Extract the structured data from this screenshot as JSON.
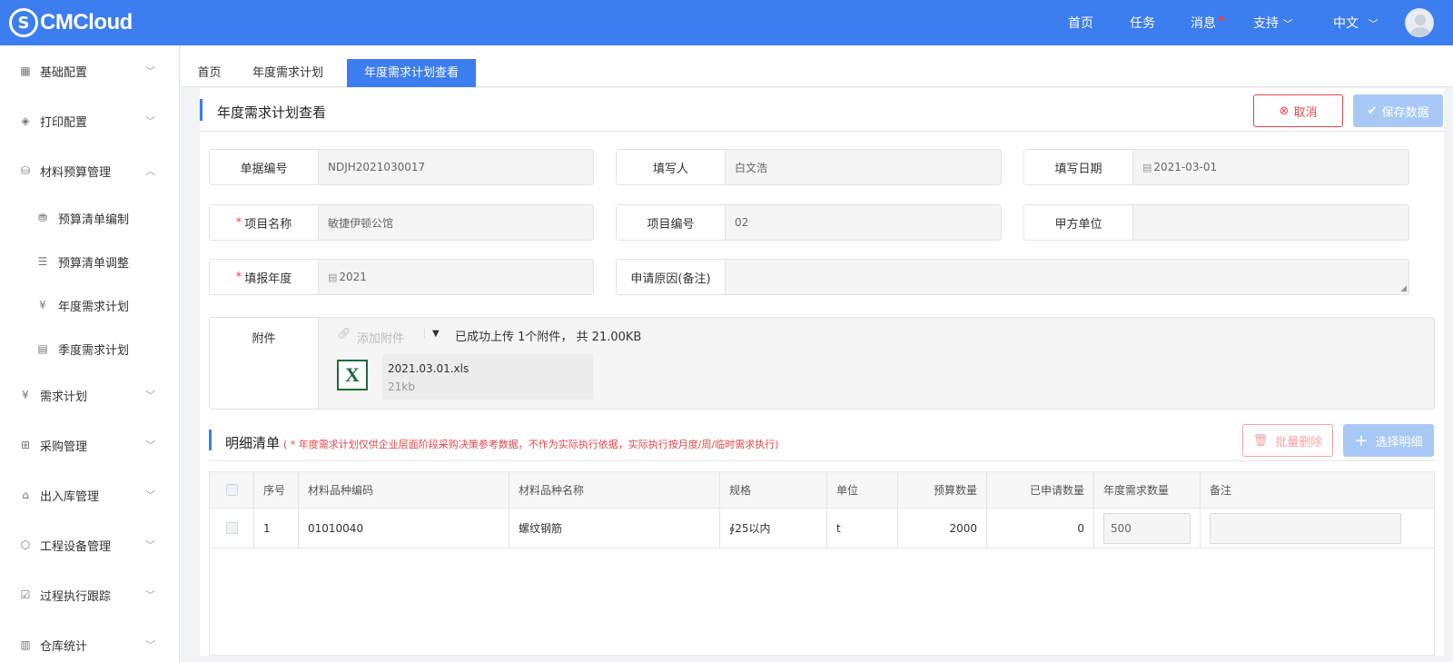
{
  "app": {
    "logo_text": "CMCloud",
    "logo_mark": "S"
  },
  "topnav": {
    "home": "首页",
    "tasks": "任务",
    "messages": "消息",
    "support": "支持",
    "language": "中文"
  },
  "sidebar": {
    "items": [
      {
        "label": "基础配置",
        "icon": "grid-icon"
      },
      {
        "label": "打印配置",
        "icon": "layers-icon"
      },
      {
        "label": "材料预算管理",
        "icon": "database-icon"
      },
      {
        "label": "预算清单编制",
        "icon": "coins-icon"
      },
      {
        "label": "预算清单调整",
        "icon": "list-doc-icon"
      },
      {
        "label": "年度需求计划",
        "icon": "yen-search-icon"
      },
      {
        "label": "季度需求计划",
        "icon": "calendar-icon"
      },
      {
        "label": "需求计划",
        "icon": "yen-search-icon"
      },
      {
        "label": "采购管理",
        "icon": "org-chart-icon"
      },
      {
        "label": "出入库管理",
        "icon": "warehouse-icon"
      },
      {
        "label": "工程设备管理",
        "icon": "cube-icon"
      },
      {
        "label": "过程执行跟踪",
        "icon": "tracking-icon"
      },
      {
        "label": "仓库统计",
        "icon": "stats-icon"
      }
    ]
  },
  "tabs": [
    {
      "label": "首页"
    },
    {
      "label": "年度需求计划"
    },
    {
      "label": "年度需求计划查看"
    }
  ],
  "page": {
    "title": "年度需求计划查看",
    "cancel_label": "取消",
    "save_label": "保存数据"
  },
  "form": {
    "doc_no": {
      "label": "单据编号",
      "value": "NDJH2021030017"
    },
    "filler": {
      "label": "填写人",
      "value": "白文浩"
    },
    "fill_date": {
      "label": "填写日期",
      "value": "2021-03-01"
    },
    "project_name": {
      "label": "项目名称",
      "value": "敏捷伊顿公馆"
    },
    "project_no": {
      "label": "项目编号",
      "value": "02"
    },
    "party_a": {
      "label": "甲方单位",
      "value": ""
    },
    "report_year": {
      "label": "填报年度",
      "value": "2021"
    },
    "reason": {
      "label": "申请原因(备注)",
      "value": ""
    },
    "required_mark": "*"
  },
  "attachment": {
    "label": "附件",
    "add_label": "添加附件",
    "summary": "已成功上传 1个附件， 共 21.00KB",
    "file": {
      "name": "2021.03.01.xls",
      "size": "21kb",
      "icon_letter": "X"
    }
  },
  "detail": {
    "title": "明细清单",
    "note": "( * 年度需求计划仅供企业层面阶段采购决策参考数据，不作为实际执行依据，实际执行按月度/周/临时需求执行)",
    "batch_delete_label": "批量删除",
    "select_label": "选择明细",
    "columns": [
      "序号",
      "材料品种编码",
      "材料品种名称",
      "规格",
      "单位",
      "预算数量",
      "已申请数量",
      "年度需求数量",
      "备注"
    ],
    "rows": [
      {
        "no": "1",
        "code": "01010040",
        "name": "螺纹钢筋",
        "spec": "∮25以内",
        "unit": "t",
        "budget_qty": "2000",
        "applied_qty": "0",
        "annual_qty": "500",
        "remark": ""
      }
    ]
  }
}
